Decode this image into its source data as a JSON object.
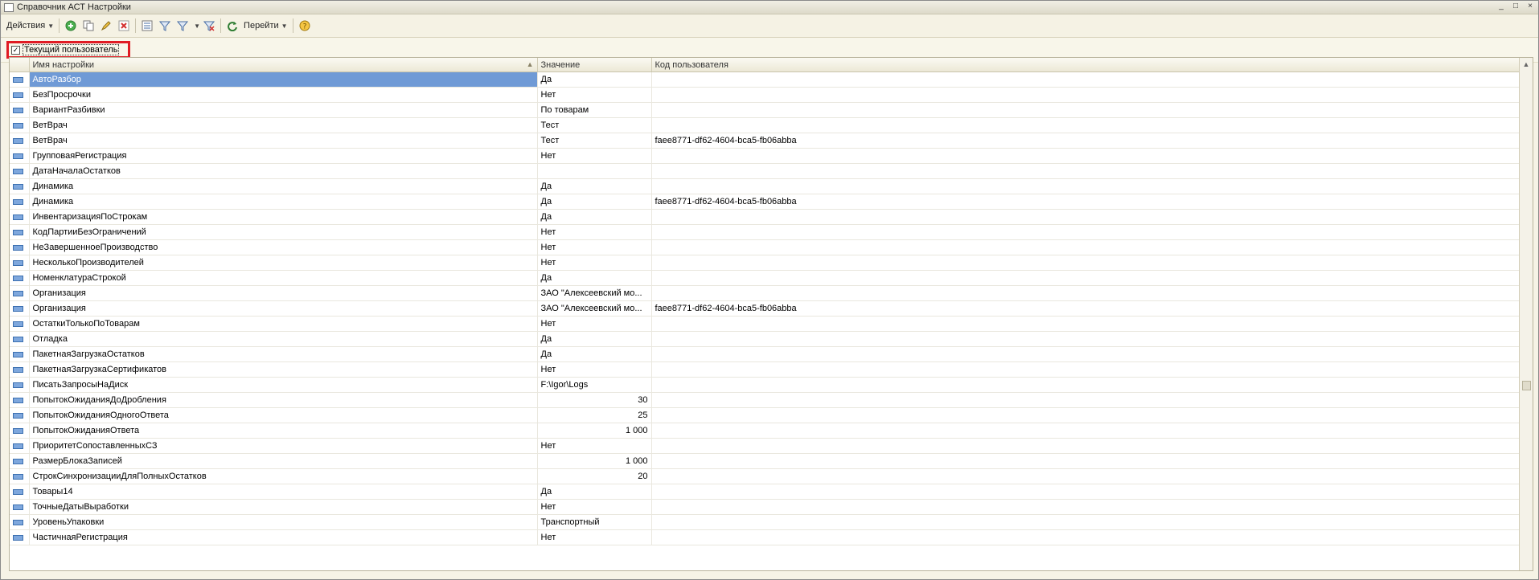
{
  "window": {
    "title": "Справочник АСТ Настройки"
  },
  "toolbar": {
    "actions_label": "Действия",
    "goto_label": "Перейти"
  },
  "filter": {
    "current_user_label": "Текущий пользователь",
    "current_user_checked": true
  },
  "table": {
    "columns": [
      "Имя настройки",
      "Значение",
      "Код пользователя"
    ],
    "rows": [
      {
        "name": "АвтоРазбор",
        "value": "Да",
        "user": "",
        "selected": true
      },
      {
        "name": "БезПросрочки",
        "value": "Нет",
        "user": ""
      },
      {
        "name": "ВариантРазбивки",
        "value": "По товарам",
        "user": ""
      },
      {
        "name": "ВетВрач",
        "value": "Тест",
        "user": ""
      },
      {
        "name": "ВетВрач",
        "value": "Тест",
        "user": "faee8771-df62-4604-bca5-fb06abba"
      },
      {
        "name": "ГрупповаяРегистрация",
        "value": "Нет",
        "user": ""
      },
      {
        "name": "ДатаНачалаОстатков",
        "value": "",
        "user": ""
      },
      {
        "name": "Динамика",
        "value": "Да",
        "user": ""
      },
      {
        "name": "Динамика",
        "value": "Да",
        "user": "faee8771-df62-4604-bca5-fb06abba"
      },
      {
        "name": "ИнвентаризацияПоСтрокам",
        "value": "Да",
        "user": ""
      },
      {
        "name": "КодПартииБезОграничений",
        "value": "Нет",
        "user": ""
      },
      {
        "name": "НеЗавершенноеПроизводство",
        "value": "Нет",
        "user": ""
      },
      {
        "name": "НесколькоПроизводителей",
        "value": "Нет",
        "user": ""
      },
      {
        "name": "НоменклатураСтрокой",
        "value": "Да",
        "user": ""
      },
      {
        "name": "Организация",
        "value": "ЗАО \"Алексеевский мо...",
        "user": ""
      },
      {
        "name": "Организация",
        "value": "ЗАО \"Алексеевский мо...",
        "user": "faee8771-df62-4604-bca5-fb06abba"
      },
      {
        "name": "ОстаткиТолькоПоТоварам",
        "value": "Нет",
        "user": ""
      },
      {
        "name": "Отладка",
        "value": "Да",
        "user": ""
      },
      {
        "name": "ПакетнаяЗагрузкаОстатков",
        "value": "Да",
        "user": ""
      },
      {
        "name": "ПакетнаяЗагрузкаСертификатов",
        "value": "Нет",
        "user": ""
      },
      {
        "name": "ПисатьЗапросыНаДиск",
        "value": "F:\\Igor\\Logs",
        "user": ""
      },
      {
        "name": "ПопытокОжиданияДоДробления",
        "value": "30",
        "user": "",
        "numeric": true
      },
      {
        "name": "ПопытокОжиданияОдногоОтвета",
        "value": "25",
        "user": "",
        "numeric": true
      },
      {
        "name": "ПопытокОжиданияОтвета",
        "value": "1 000",
        "user": "",
        "numeric": true
      },
      {
        "name": "ПриоритетСопоставленныхСЗ",
        "value": "Нет",
        "user": ""
      },
      {
        "name": "РазмерБлокаЗаписей",
        "value": "1 000",
        "user": "",
        "numeric": true
      },
      {
        "name": "СтрокСинхронизацииДляПолныхОстатков",
        "value": "20",
        "user": "",
        "numeric": true
      },
      {
        "name": "Товары14",
        "value": "Да",
        "user": ""
      },
      {
        "name": "ТочныеДатыВыработки",
        "value": "Нет",
        "user": ""
      },
      {
        "name": "УровеньУпаковки",
        "value": "Транспортный",
        "user": ""
      },
      {
        "name": "ЧастичнаяРегистрация",
        "value": "Нет",
        "user": ""
      }
    ]
  },
  "colors": {
    "selection": "#6f9ad6",
    "highlight_border": "#e01b24"
  }
}
